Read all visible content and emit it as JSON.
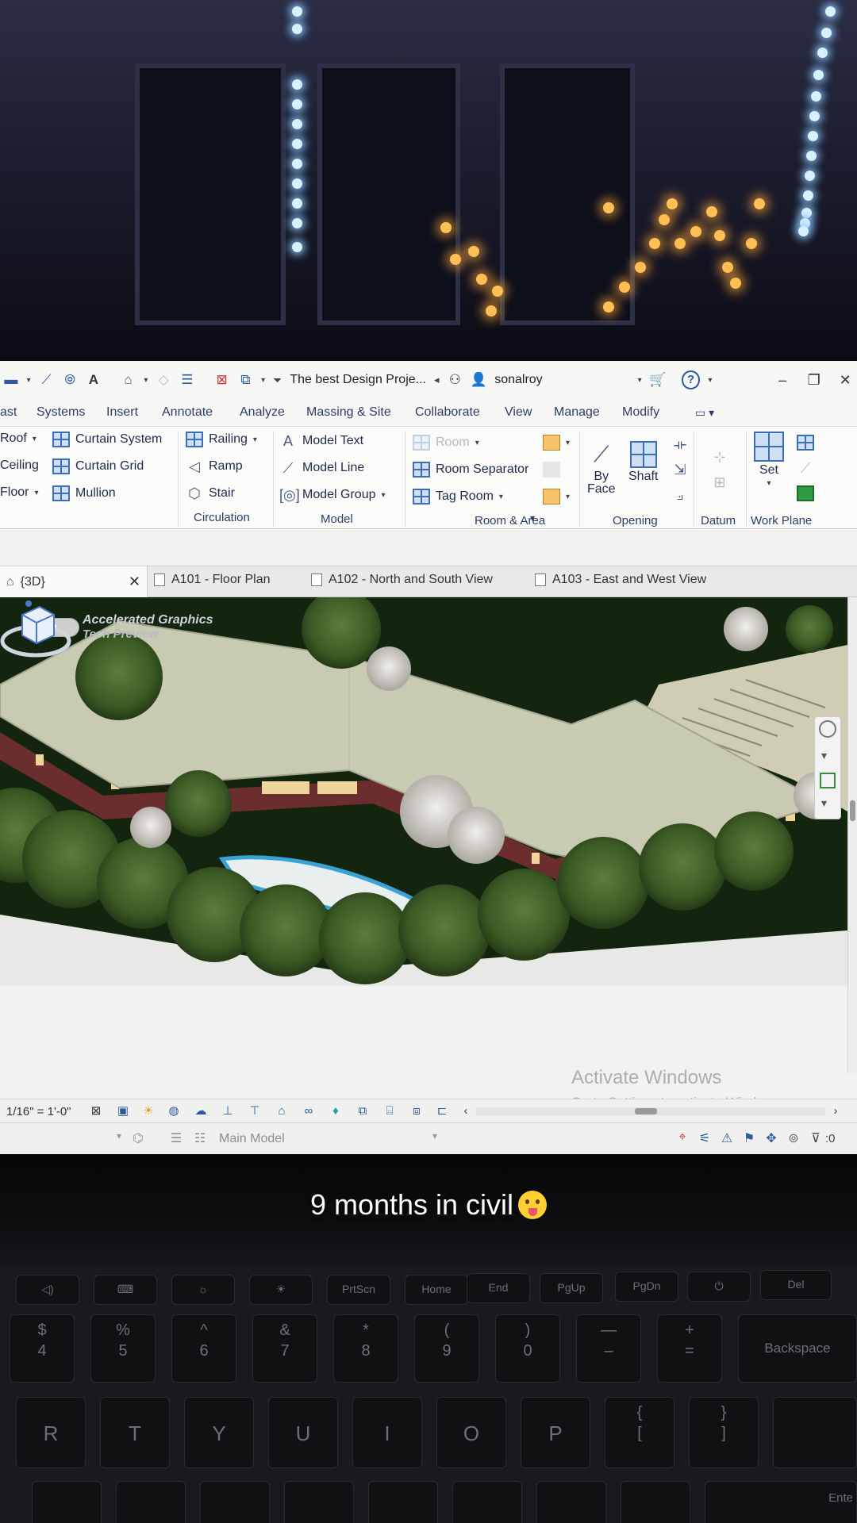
{
  "title_bar": {
    "document_title": "The best Design Proje...",
    "user_name": "sonalroy",
    "help_icon": "?"
  },
  "ribbon_tabs": [
    "ast",
    "Systems",
    "Insert",
    "Annotate",
    "Analyze",
    "Massing & Site",
    "Collaborate",
    "View",
    "Manage",
    "Modify"
  ],
  "ribbon": {
    "build": {
      "roof": "Roof",
      "ceiling": "Ceiling",
      "floor": "Floor",
      "curtain_system": "Curtain System",
      "curtain_grid": "Curtain Grid",
      "mullion": "Mullion"
    },
    "circulation": {
      "railing": "Railing",
      "ramp": "Ramp",
      "stair": "Stair",
      "label": "Circulation"
    },
    "model": {
      "model_text": "Model Text",
      "model_line": "Model Line",
      "model_group": "Model Group",
      "label": "Model"
    },
    "room_area": {
      "room": "Room",
      "room_separator": "Room Separator",
      "tag_room": "Tag Room",
      "label": "Room & Area"
    },
    "opening": {
      "by_face_1": "By",
      "by_face_2": "Face",
      "shaft": "Shaft",
      "label": "Opening"
    },
    "datum": {
      "label": "Datum"
    },
    "work_plane": {
      "set": "Set",
      "label": "Work Plane"
    }
  },
  "view_tabs": [
    {
      "label": "{3D}",
      "active": true
    },
    {
      "label": "A101 - Floor Plan"
    },
    {
      "label": "A102 - North and South View"
    },
    {
      "label": "A103 - East and West View"
    }
  ],
  "viewport": {
    "accel_title": "Accelerated Graphics",
    "accel_subtitle": "Tech Preview"
  },
  "watermark": {
    "line1": "Activate Windows",
    "line2": "Go to Settings to activate Windows."
  },
  "view_control": {
    "scale": "1/16\" = 1'-0\""
  },
  "status_bar": {
    "main_model": "Main Model",
    "filter_count": ":0"
  },
  "caption": "9 months in civil",
  "keyboard": {
    "fn_row": [
      "PrtScn",
      "Home",
      "End",
      "PgUp",
      "PgDn",
      "Del"
    ],
    "num_row": [
      {
        "top": "$",
        "bot": "4"
      },
      {
        "top": "%",
        "bot": "5"
      },
      {
        "top": "^",
        "bot": "6"
      },
      {
        "top": "&",
        "bot": "7"
      },
      {
        "top": "*",
        "bot": "8"
      },
      {
        "top": "(",
        "bot": "9"
      },
      {
        "top": ")",
        "bot": "0"
      },
      {
        "top": "—",
        "bot": "–"
      },
      {
        "top": "+",
        "bot": "="
      }
    ],
    "backspace": "Backspace",
    "letter_row": [
      "R",
      "T",
      "Y",
      "U",
      "I",
      "O",
      "P"
    ],
    "bracket_keys": [
      {
        "top": "{",
        "bot": "["
      },
      {
        "top": "}",
        "bot": "]"
      }
    ],
    "enter_partial": "Ente"
  },
  "colors": {
    "ribbon_text": "#2b3d66",
    "accent": "#2c5aa0",
    "roof": "#c9cbb2",
    "ground": "#12240f"
  }
}
